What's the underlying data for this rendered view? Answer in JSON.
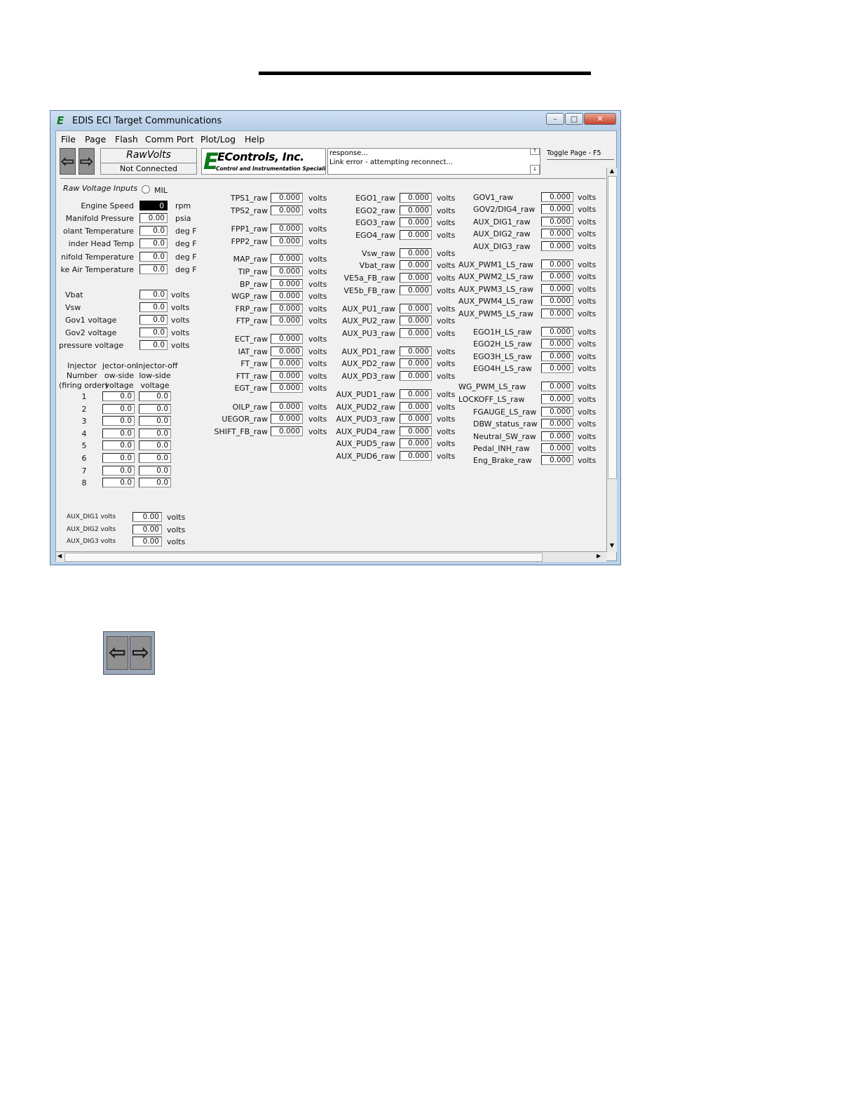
{
  "window": {
    "title": "EDIS ECI Target Communications",
    "controls": {
      "minimize": "–",
      "maximize": "□",
      "close": "✕"
    }
  },
  "menu": [
    "File",
    "Page",
    "Flash",
    "Comm Port",
    "Plot/Log",
    "Help"
  ],
  "toolbar": {
    "page_name": "RawVolts",
    "connection_status": "Not Connected",
    "logo_title": "EControls, Inc.",
    "logo_subtitle": "Control and Instrumentation Specialists",
    "response_lines": [
      "response...",
      "Link error - attempting reconnect..."
    ],
    "toggle_page": "Toggle Page - F5"
  },
  "left_panel": {
    "section_title": "Raw Voltage Inputs",
    "mil_label": "MIL",
    "sensors": [
      {
        "label": "Engine Speed",
        "value": "0",
        "unit": "rpm"
      },
      {
        "label": "Manifold Pressure",
        "value": "0.00",
        "unit": "psia"
      },
      {
        "label": "olant Temperature",
        "value": "0.0",
        "unit": "deg F"
      },
      {
        "label": "inder Head Temp",
        "value": "0.0",
        "unit": "deg F"
      },
      {
        "label": "nifold Temperature",
        "value": "0.0",
        "unit": "deg F"
      },
      {
        "label": "ke Air Temperature",
        "value": "0.0",
        "unit": "deg F"
      }
    ],
    "supplies": [
      {
        "label": "Vbat",
        "value": "0.0",
        "unit": "volts"
      },
      {
        "label": "Vsw",
        "value": "0.0",
        "unit": "volts"
      },
      {
        "label": "Gov1 voltage",
        "value": "0.0",
        "unit": "volts"
      },
      {
        "label": "Gov2 voltage",
        "value": "0.0",
        "unit": "volts"
      },
      {
        "label": "pressure voltage",
        "value": "0.0",
        "unit": "volts"
      }
    ],
    "injector_headers": [
      [
        "Injector",
        "Number",
        "(firing order)"
      ],
      [
        "jector-on",
        "ow-side",
        "voltage"
      ],
      [
        "Injector-off",
        "low-side",
        "voltage"
      ]
    ],
    "injectors": [
      {
        "num": "1",
        "on": "0.0",
        "off": "0.0"
      },
      {
        "num": "2",
        "on": "0.0",
        "off": "0.0"
      },
      {
        "num": "3",
        "on": "0.0",
        "off": "0.0"
      },
      {
        "num": "4",
        "on": "0.0",
        "off": "0.0"
      },
      {
        "num": "5",
        "on": "0.0",
        "off": "0.0"
      },
      {
        "num": "6",
        "on": "0.0",
        "off": "0.0"
      },
      {
        "num": "7",
        "on": "0.0",
        "off": "0.0"
      },
      {
        "num": "8",
        "on": "0.0",
        "off": "0.0"
      }
    ],
    "aux_dig": [
      {
        "label": "AUX_DIG1 volts",
        "value": "0.00",
        "unit": "volts"
      },
      {
        "label": "AUX_DIG2 volts",
        "value": "0.00",
        "unit": "volts"
      },
      {
        "label": "AUX_DIG3 volts",
        "value": "0.00",
        "unit": "volts"
      }
    ]
  },
  "column2": [
    {
      "label": "TPS1_raw",
      "value": "0.000",
      "unit": "volts"
    },
    {
      "label": "TPS2_raw",
      "value": "0.000",
      "unit": "volts"
    },
    {
      "label": "FPP1_raw",
      "value": "0.000",
      "unit": "volts"
    },
    {
      "label": "FPP2_raw",
      "value": "0.000",
      "unit": "volts"
    },
    {
      "label": "MAP_raw",
      "value": "0.000",
      "unit": "volts"
    },
    {
      "label": "TIP_raw",
      "value": "0.000",
      "unit": "volts"
    },
    {
      "label": "BP_raw",
      "value": "0.000",
      "unit": "volts"
    },
    {
      "label": "WGP_raw",
      "value": "0.000",
      "unit": "volts"
    },
    {
      "label": "FRP_raw",
      "value": "0.000",
      "unit": "volts"
    },
    {
      "label": "FTP_raw",
      "value": "0.000",
      "unit": "volts"
    },
    {
      "label": "ECT_raw",
      "value": "0.000",
      "unit": "volts"
    },
    {
      "label": "IAT_raw",
      "value": "0.000",
      "unit": "volts"
    },
    {
      "label": "FT_raw",
      "value": "0.000",
      "unit": "volts"
    },
    {
      "label": "FTT_raw",
      "value": "0.000",
      "unit": "volts"
    },
    {
      "label": "EGT_raw",
      "value": "0.000",
      "unit": "volts"
    },
    {
      "label": "OILP_raw",
      "value": "0.000",
      "unit": "volts"
    },
    {
      "label": "UEGOR_raw",
      "value": "0.000",
      "unit": "volts"
    },
    {
      "label": "SHIFT_FB_raw",
      "value": "0.000",
      "unit": "volts"
    }
  ],
  "column3": [
    {
      "label": "EGO1_raw",
      "value": "0.000",
      "unit": "volts"
    },
    {
      "label": "EGO2_raw",
      "value": "0.000",
      "unit": "volts"
    },
    {
      "label": "EGO3_raw",
      "value": "0.000",
      "unit": "volts"
    },
    {
      "label": "EGO4_raw",
      "value": "0.000",
      "unit": "volts"
    },
    {
      "label": "Vsw_raw",
      "value": "0.000",
      "unit": "volts"
    },
    {
      "label": "Vbat_raw",
      "value": "0.000",
      "unit": "volts"
    },
    {
      "label": "VE5a_FB_raw",
      "value": "0.000",
      "unit": "volts"
    },
    {
      "label": "VE5b_FB_raw",
      "value": "0.000",
      "unit": "volts"
    },
    {
      "label": "AUX_PU1_raw",
      "value": "0.000",
      "unit": "volts"
    },
    {
      "label": "AUX_PU2_raw",
      "value": "0.000",
      "unit": "volts"
    },
    {
      "label": "AUX_PU3_raw",
      "value": "0.000",
      "unit": "volts"
    },
    {
      "label": "AUX_PD1_raw",
      "value": "0.000",
      "unit": "volts"
    },
    {
      "label": "AUX_PD2_raw",
      "value": "0.000",
      "unit": "volts"
    },
    {
      "label": "AUX_PD3_raw",
      "value": "0.000",
      "unit": "volts"
    },
    {
      "label": "AUX_PUD1_raw",
      "value": "0.000",
      "unit": "volts"
    },
    {
      "label": "AUX_PUD2_raw",
      "value": "0.000",
      "unit": "volts"
    },
    {
      "label": "AUX_PUD3_raw",
      "value": "0.000",
      "unit": "volts"
    },
    {
      "label": "AUX_PUD4_raw",
      "value": "0.000",
      "unit": "volts"
    },
    {
      "label": "AUX_PUD5_raw",
      "value": "0.000",
      "unit": "volts"
    },
    {
      "label": "AUX_PUD6_raw",
      "value": "0.000",
      "unit": "volts"
    }
  ],
  "column4": [
    {
      "label": "GOV1_raw",
      "value": "0.000",
      "unit": "volts"
    },
    {
      "label": "GOV2/DIG4_raw",
      "value": "0.000",
      "unit": "volts"
    },
    {
      "label": "AUX_DIG1_raw",
      "value": "0.000",
      "unit": "volts"
    },
    {
      "label": "AUX_DIG2_raw",
      "value": "0.000",
      "unit": "volts"
    },
    {
      "label": "AUX_DIG3_raw",
      "value": "0.000",
      "unit": "volts"
    },
    {
      "label": "AUX_PWM1_LS_raw",
      "value": "0.000",
      "unit": "volts"
    },
    {
      "label": "AUX_PWM2_LS_raw",
      "value": "0.000",
      "unit": "volts"
    },
    {
      "label": "AUX_PWM3_LS_raw",
      "value": "0.000",
      "unit": "volts"
    },
    {
      "label": "AUX_PWM4_LS_raw",
      "value": "0.000",
      "unit": "volts"
    },
    {
      "label": "AUX_PWM5_LS_raw",
      "value": "0.000",
      "unit": "volts"
    },
    {
      "label": "EGO1H_LS_raw",
      "value": "0.000",
      "unit": "volts"
    },
    {
      "label": "EGO2H_LS_raw",
      "value": "0.000",
      "unit": "volts"
    },
    {
      "label": "EGO3H_LS_raw",
      "value": "0.000",
      "unit": "volts"
    },
    {
      "label": "EGO4H_LS_raw",
      "value": "0.000",
      "unit": "volts"
    },
    {
      "label": "WG_PWM_LS_raw",
      "value": "0.000",
      "unit": "volts"
    },
    {
      "label": "LOCKOFF_LS_raw",
      "value": "0.000",
      "unit": "volts"
    },
    {
      "label": "FGAUGE_LS_raw",
      "value": "0.000",
      "unit": "volts"
    },
    {
      "label": "DBW_status_raw",
      "value": "0.000",
      "unit": "volts"
    },
    {
      "label": "Neutral_SW_raw",
      "value": "0.000",
      "unit": "volts"
    },
    {
      "label": "Pedal_INH_raw",
      "value": "0.000",
      "unit": "volts"
    },
    {
      "label": "Eng_Brake_raw",
      "value": "0.000",
      "unit": "volts"
    }
  ],
  "colors": {
    "logo_green": "#0a7a1a",
    "nav_gray": "#909090"
  }
}
